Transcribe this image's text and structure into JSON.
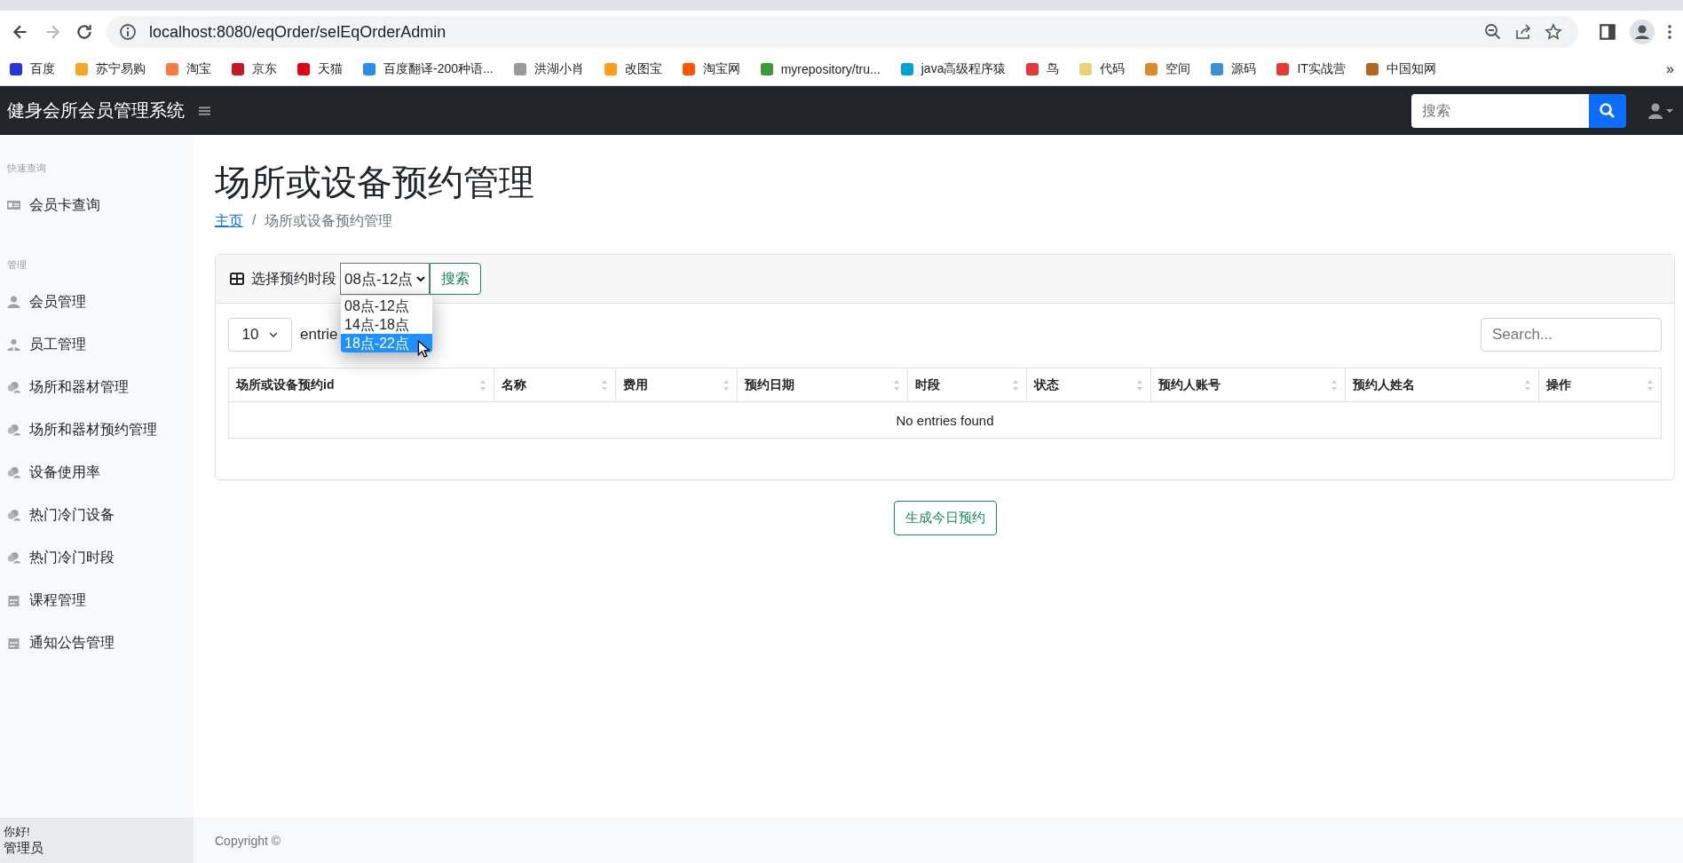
{
  "browser": {
    "url": "localhost:8080/eqOrder/selEqOrderAdmin",
    "forward_disabled": true,
    "bookmarks": [
      {
        "label": "百度",
        "color": "#2932e1"
      },
      {
        "label": "苏宁易购",
        "color": "#f5a623"
      },
      {
        "label": "淘宝",
        "color": "#ff7a3d"
      },
      {
        "label": "京东",
        "color": "#c81623"
      },
      {
        "label": "天猫",
        "color": "#e50012"
      },
      {
        "label": "百度翻译-200种语...",
        "color": "#2b8cf0"
      },
      {
        "label": "洪湖小肖",
        "color": "#9a9a9a"
      },
      {
        "label": "改图宝",
        "color": "#ff9d1a"
      },
      {
        "label": "淘宝网",
        "color": "#ff5500"
      },
      {
        "label": "myrepository/tru...",
        "color": "#3a9a3a"
      },
      {
        "label": "java高级程序猿",
        "color": "#00a1d6"
      },
      {
        "label": "鸟",
        "color": "#e6383a"
      },
      {
        "label": "代码",
        "color": "#e8d27a"
      },
      {
        "label": "空间",
        "color": "#d98b2b"
      },
      {
        "label": "源码",
        "color": "#3b8fd4"
      },
      {
        "label": "IT实战营",
        "color": "#e53935"
      },
      {
        "label": "中国知网",
        "color": "#b5651d"
      }
    ],
    "overflow": "»"
  },
  "navbar": {
    "brand": "健身会所会员管理系统",
    "search_placeholder": "搜索"
  },
  "sidebar": {
    "sections": [
      {
        "heading": "快速查询",
        "items": [
          {
            "label": "会员卡查询",
            "kind": "card"
          }
        ]
      },
      {
        "heading": "管理",
        "items": [
          {
            "label": "会员管理",
            "kind": "user"
          },
          {
            "label": "员工管理",
            "kind": "users"
          },
          {
            "label": "场所和器材管理",
            "kind": "group"
          },
          {
            "label": "场所和器材预约管理",
            "kind": "group"
          },
          {
            "label": "设备使用率",
            "kind": "group"
          },
          {
            "label": "热门冷门设备",
            "kind": "group"
          },
          {
            "label": "热门冷门时段",
            "kind": "group"
          },
          {
            "label": "课程管理",
            "kind": "calendar"
          },
          {
            "label": "通知公告管理",
            "kind": "calendar"
          }
        ]
      }
    ],
    "footer": {
      "greeting": "你好!",
      "role": "管理员"
    }
  },
  "page": {
    "title": "场所或设备预约管理",
    "breadcrumb": {
      "home": "主页",
      "separator": "/",
      "current": "场所或设备预约管理"
    }
  },
  "card": {
    "filter_label": "选择预约时段",
    "select_value": "08点-12点",
    "search_button": "搜索",
    "options": [
      {
        "label": "08点-12点",
        "highlighted": false
      },
      {
        "label": "14点-18点",
        "highlighted": false
      },
      {
        "label": "18点-22点",
        "highlighted": true
      }
    ],
    "page_size": "10",
    "entries_text": "entrie",
    "search_placeholder": "Search...",
    "table": {
      "columns": [
        "场所或设备预约id",
        "名称",
        "费用",
        "预约日期",
        "时段",
        "状态",
        "预约人账号",
        "预约人姓名",
        "操作"
      ],
      "empty_text": "No entries found"
    }
  },
  "generate_button": "生成今日预约",
  "footer": {
    "copyright": "Copyright ©"
  }
}
